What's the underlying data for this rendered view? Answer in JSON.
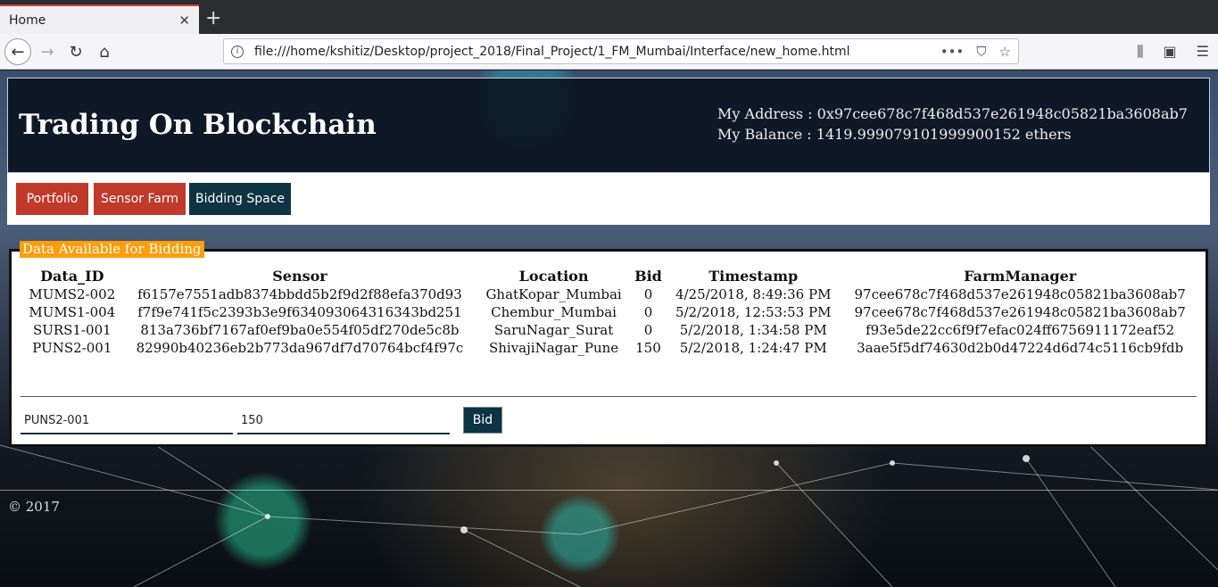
{
  "browser": {
    "tab_title": "Home",
    "tab_close": "✕",
    "new_tab": "+",
    "url": "file:///home/kshitiz/Desktop/project_2018/Final_Project/1_FM_Mumbai/Interface/new_home.html"
  },
  "header": {
    "title": "Trading On Blockchain",
    "address_line": "My Address : 0x97cee678c7f468d537e261948c05821ba3608ab7",
    "balance_line": "My Balance : 1419.999079101999900152 ethers"
  },
  "menu": {
    "portfolio": "Portfolio",
    "sensor_farm": "Sensor Farm",
    "bidding_space": "Bidding Space"
  },
  "panel": {
    "label": "Data Available for Bidding",
    "columns": [
      "Data_ID",
      "Sensor",
      "Location",
      "Bid",
      "Timestamp",
      "FarmManager"
    ],
    "rows": [
      [
        "MUMS2-002",
        "f6157e7551adb8374bbdd5b2f9d2f88efa370d93",
        "GhatKopar_Mumbai",
        "0",
        "4/25/2018, 8:49:36 PM",
        "97cee678c7f468d537e261948c05821ba3608ab7"
      ],
      [
        "MUMS1-004",
        "f7f9e741f5c2393b3e9f634093064316343bd251",
        "Chembur_Mumbai",
        "0",
        "5/2/2018, 12:53:53 PM",
        "97cee678c7f468d537e261948c05821ba3608ab7"
      ],
      [
        "SURS1-001",
        "813a736bf7167af0ef9ba0e554f05df270de5c8b",
        "SaruNagar_Surat",
        "0",
        "5/2/2018, 1:34:58 PM",
        "f93e5de22cc6f9f7efac024ff6756911172eaf52"
      ],
      [
        "PUNS2-001",
        "82990b40236eb2b773da967df7d70764bcf4f97c",
        "ShivajiNagar_Pune",
        "150",
        "5/2/2018, 1:24:47 PM",
        "3aae5f5df74630d2b0d47224d6d74c5116cb9fdb"
      ]
    ],
    "data_id_value": "PUNS2-001",
    "bid_value": "150",
    "bid_button": "Bid"
  },
  "footer": {
    "text": "© 2017"
  },
  "colors": {
    "header_bg": "#0a121e",
    "button_red": "#c0392b",
    "button_dark": "#0e3342",
    "label_orange": "#ff9d0a"
  }
}
